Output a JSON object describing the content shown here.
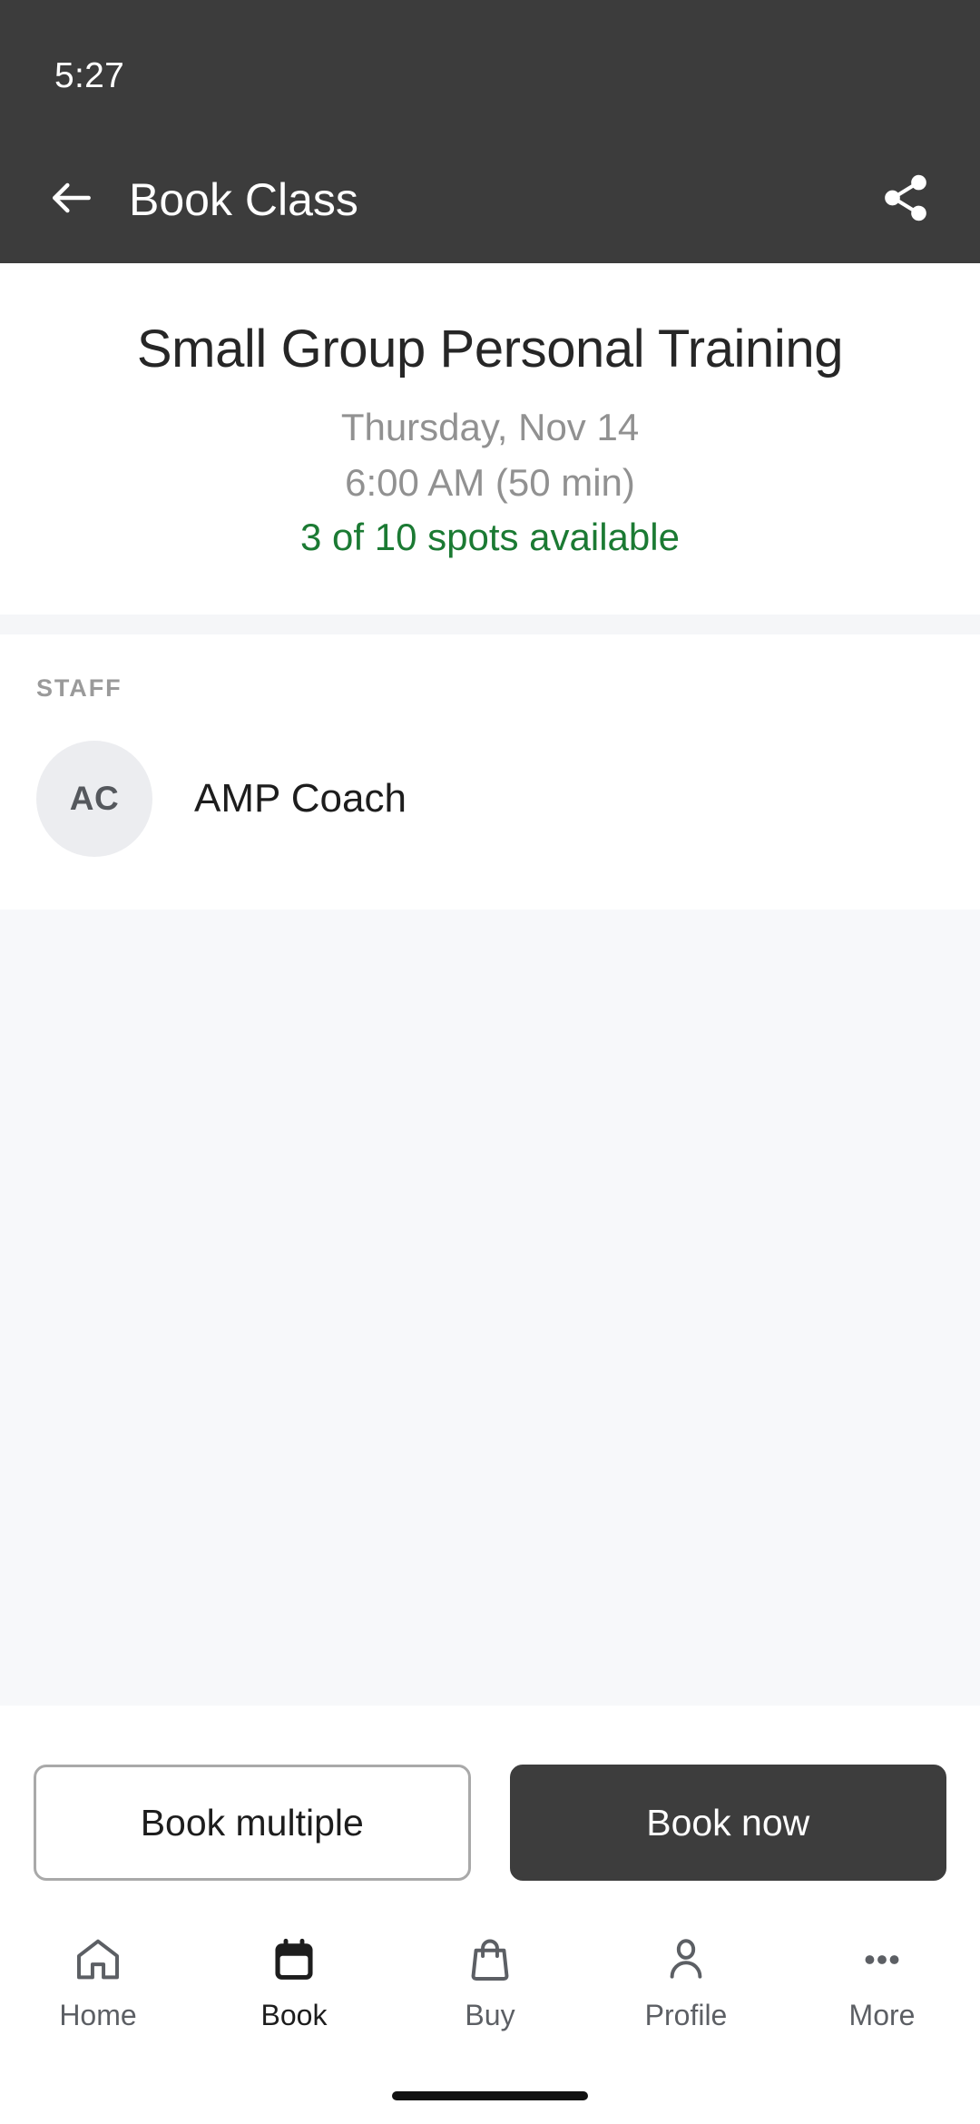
{
  "status_bar": {
    "time": "5:27"
  },
  "app_bar": {
    "back_icon": "arrow-left-icon",
    "title": "Book Class",
    "share_icon": "share-icon",
    "background_color": "#3c3c3c"
  },
  "class": {
    "title": "Small Group Personal Training",
    "date": "Thursday, Nov 14",
    "time": "6:00 AM (50 min)",
    "spots": "3 of 10 spots available",
    "spots_color": "#1b7a33",
    "spots_open": 3,
    "spots_total": 10
  },
  "staff": {
    "section_label": "STAFF",
    "members": [
      {
        "initials": "AC",
        "name": "AMP Coach"
      }
    ]
  },
  "actions": {
    "secondary_label": "Book multiple",
    "primary_label": "Book now",
    "primary_color": "#3d3d3d"
  },
  "bottom_nav": {
    "items": [
      {
        "label": "Home",
        "icon": "home-icon",
        "active": false
      },
      {
        "label": "Book",
        "icon": "calendar-icon",
        "active": true
      },
      {
        "label": "Buy",
        "icon": "shopping-bag-icon",
        "active": false
      },
      {
        "label": "Profile",
        "icon": "person-icon",
        "active": false
      },
      {
        "label": "More",
        "icon": "ellipsis-icon",
        "active": false
      }
    ]
  }
}
